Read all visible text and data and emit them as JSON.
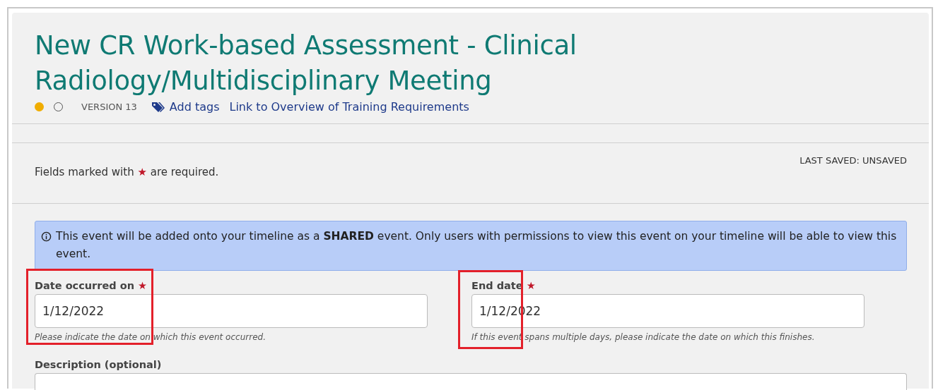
{
  "header": {
    "title": "New CR Work-based Assessment - Clinical Radiology/Multidisciplinary Meeting",
    "status_dots": [
      {
        "filled": true,
        "color": "#f0ad00"
      },
      {
        "filled": false,
        "color": "#555555"
      }
    ],
    "version": "VERSION 13",
    "add_tags": "Add tags",
    "link": "Link to Overview of Training Requirements"
  },
  "notice": {
    "required_before": "Fields marked with",
    "required_mark": "★",
    "required_after": "are required.",
    "last_saved": "LAST SAVED: UNSAVED"
  },
  "info": {
    "text": "This event will be added onto your timeline as a **SHARED** event. Only users with permissions to view this event on your timeline will be able to view this event."
  },
  "fields": [
    {
      "label": "Date occurred on",
      "required": true,
      "value": "1/12/2022",
      "help": "Please indicate the date on which this event occurred.",
      "highlighted": true
    },
    {
      "label": "End date",
      "required": true,
      "value": "1/12/2022",
      "help": "If this event spans multiple days, please indicate the date on which this finishes.",
      "highlighted": true
    }
  ],
  "description": {
    "label": "Description (optional)"
  }
}
